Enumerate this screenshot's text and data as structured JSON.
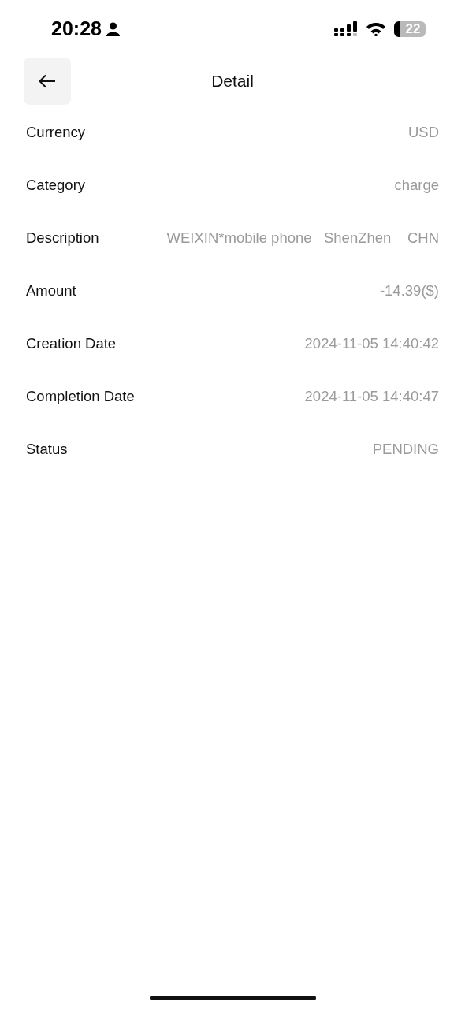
{
  "status_bar": {
    "time": "20:28",
    "battery": "22"
  },
  "header": {
    "title": "Detail"
  },
  "rows": [
    {
      "label": "Currency",
      "value": "USD"
    },
    {
      "label": "Category",
      "value": "charge"
    },
    {
      "label": "Description",
      "value": "WEIXIN*mobile phone   ShenZhen    CHN"
    },
    {
      "label": "Amount",
      "value": "-14.39($)"
    },
    {
      "label": "Creation Date",
      "value": "2024-11-05 14:40:42"
    },
    {
      "label": "Completion Date",
      "value": "2024-11-05 14:40:47"
    },
    {
      "label": "Status",
      "value": "PENDING"
    }
  ]
}
